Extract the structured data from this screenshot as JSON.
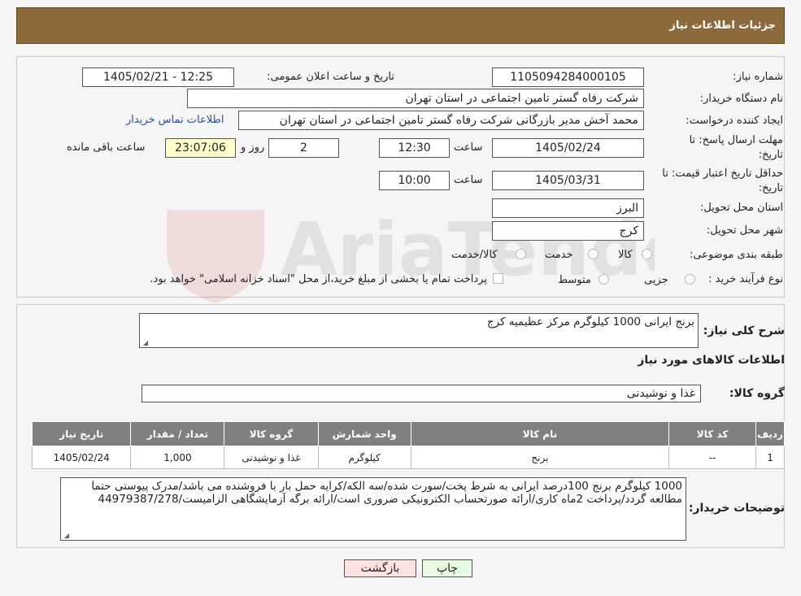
{
  "header": {
    "title": "جزئیات اطلاعات نیاز"
  },
  "watermark": {
    "text": "AriaTender.neT"
  },
  "form": {
    "need_number_label": "شماره نیاز:",
    "need_number": "1105094284000105",
    "announce_label": "تاریخ و ساعت اعلان عمومی:",
    "announce_value": "1405/02/21 - 12:25",
    "buyer_org_label": "نام دستگاه خریدار:",
    "buyer_org": "شرکت رفاه گستر تامین اجتماعی در استان تهران",
    "requester_label": "ایجاد کننده درخواست:",
    "requester": "محمد آخش مدیر بازرگانی شرکت رفاه گستر تامین اجتماعی در استان تهران",
    "buyer_contact_link": "اطلاعات تماس خریدار",
    "deadline_label": "مهلت ارسال پاسخ: تا تاریخ:",
    "deadline_date": "1405/02/24",
    "time_label": "ساعت",
    "deadline_time": "12:30",
    "days_value": "2",
    "days_label": "روز و",
    "remaining_time": "23:07:06",
    "remaining_label": "ساعت باقی مانده",
    "validity_label": "حداقل تاریخ اعتبار قیمت: تا تاریخ:",
    "validity_date": "1405/03/31",
    "validity_time": "10:00",
    "province_label": "استان محل تحویل:",
    "province": "البرز",
    "city_label": "شهر محل تحویل:",
    "city": "کرج",
    "category_label": "طبقه بندی موضوعی:",
    "category_options": [
      "کالا",
      "خدمت",
      "کالا/خدمت"
    ],
    "process_label": "نوع فرآیند خرید :",
    "process_options": [
      "جزیی",
      "متوسط"
    ],
    "payment_note": "پرداخت تمام یا بخشی از مبلغ خرید،از محل \"اسناد خزانه اسلامی\" خواهد بود."
  },
  "details": {
    "summary_label": "شرح کلی نیاز:",
    "summary": "برنج ایرانی 1000 کیلوگرم مرکز عظیمیه کرج",
    "goods_info_title": "اطلاعات کالاهای مورد نیاز",
    "goods_group_label": "گروه کالا:",
    "goods_group": "غذا و نوشیدنی",
    "table": {
      "headers": [
        "ردیف",
        "کد کالا",
        "نام کالا",
        "واحد شمارش",
        "گروه کالا",
        "تعداد / مقدار",
        "تاریخ نیاز"
      ],
      "rows": [
        [
          "1",
          "--",
          "برنج",
          "کیلوگرم",
          "غذا و نوشیدنی",
          "1,000",
          "1405/02/24"
        ]
      ]
    },
    "buyer_notes_label": "توضیحات خریدار:",
    "buyer_notes": "1000 کیلوگرم برنج 100درصد ایرانی به شرط پخت/سورت شده/سه الکه/کرایه حمل بار با فروشنده می باشد/مدرک پیوستی حتما مطالعه گردد/پرداخت 2ماه کاری/ارائه صورتحساب الکترونیکی ضروری است/ارائه برگه آزمایشگاهی الزامیست/44979387/278"
  },
  "buttons": {
    "print": "چاپ",
    "back": "بازگشت"
  },
  "colors": {
    "header": "#8c6a3c",
    "link": "#2b4ea8",
    "table_header": "#808080",
    "back_button": "#fde2e2",
    "print_button": "#e7fbe0"
  }
}
